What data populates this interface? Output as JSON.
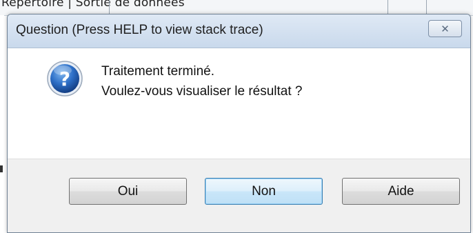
{
  "background_window": {
    "visible_text": "Répertoire  |  Sortie de données"
  },
  "dialog": {
    "title": "Question (Press HELP to view stack trace)",
    "close_glyph": "✕",
    "icon": "question-icon",
    "message_line1": "Traitement terminé.",
    "message_line2": "Voulez-vous visualiser le résultat ?",
    "buttons": {
      "yes": "Oui",
      "no": "Non",
      "help": "Aide"
    },
    "default_button": "no"
  },
  "colors": {
    "titlebar": "#c9d9ec",
    "footer": "#f0f0f0",
    "default_button_border": "#3c7fb1",
    "icon_blue": "#1f5fb4"
  }
}
